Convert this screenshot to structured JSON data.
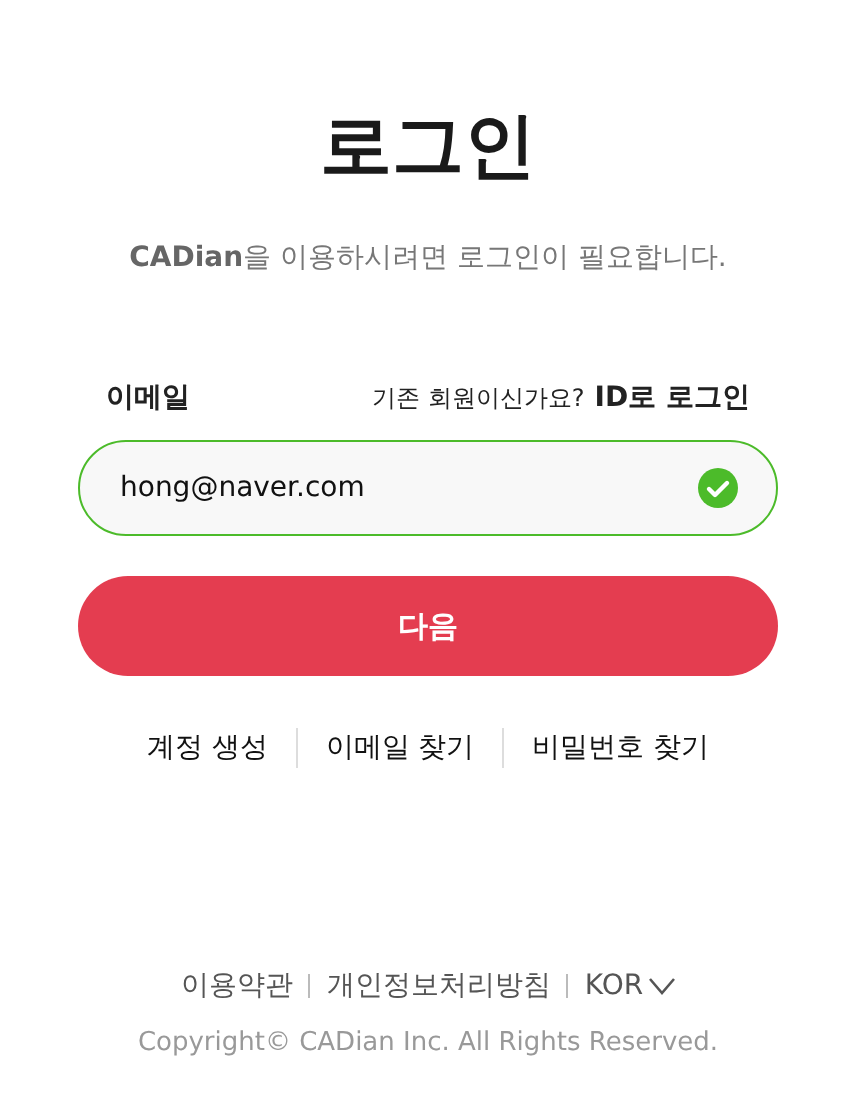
{
  "title": "로그인",
  "subtitle": "**CADian**을 이용하시려면 로그인이 필요합니다.",
  "email": {
    "label": "이메일",
    "prompt": "기존 회원이신가요?",
    "id_login_link": "ID로 로그인",
    "value": "hong@naver.com",
    "valid": true
  },
  "next_button": "다음",
  "links": [
    "계정 생성",
    "이메일 찾기",
    "비밀번호 찾기"
  ],
  "footer": {
    "links": [
      "이용약관",
      "개인정보처리방침"
    ],
    "language": "KOR",
    "copyright": "Copyright© CADian Inc. All Rights Reserved."
  }
}
